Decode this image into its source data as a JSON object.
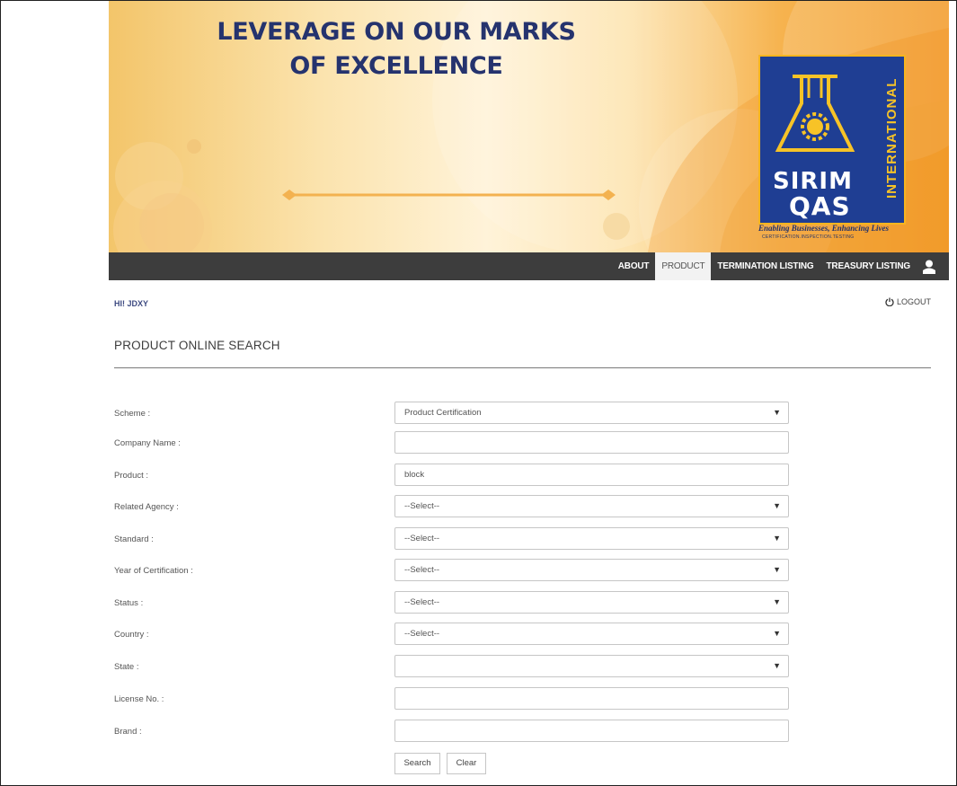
{
  "banner": {
    "headline_line1": "LEVERAGE ON OUR MARKS",
    "headline_line2": "OF EXCELLENCE",
    "logo": {
      "side_text": "INTERNATIONAL",
      "name_line1": "SIRIM",
      "name_line2": "QAS",
      "tagline": "Enabling Businesses, Enhancing Lives",
      "subtagline": "CERTIFICATION.INSPECTION.TESTING"
    },
    "colors": {
      "navy": "#25336e",
      "logo_blue": "#1f3e93",
      "logo_gold": "#f7b51f",
      "orange": "#f39a28"
    }
  },
  "nav": {
    "items": [
      {
        "label": "ABOUT",
        "active": false
      },
      {
        "label": "PRODUCT",
        "active": true
      },
      {
        "label": "TERMINATION LISTING",
        "active": false
      },
      {
        "label": "TREASURY LISTING",
        "active": false
      }
    ],
    "user_icon": "user-icon"
  },
  "header": {
    "greeting": "HI! JDXY",
    "logout_label": "LOGOUT",
    "logout_icon": "power-icon"
  },
  "page": {
    "title": "PRODUCT ONLINE SEARCH"
  },
  "form": {
    "scheme": {
      "label": "Scheme :",
      "value": "Product Certification"
    },
    "company_name": {
      "label": "Company Name :",
      "value": ""
    },
    "product": {
      "label": "Product :",
      "value": "block"
    },
    "related_agency": {
      "label": "Related Agency :",
      "value": "--Select--"
    },
    "standard": {
      "label": "Standard :",
      "value": "--Select--"
    },
    "year_of_certification": {
      "label": "Year of Certification :",
      "value": "--Select--"
    },
    "status": {
      "label": "Status :",
      "value": "--Select--"
    },
    "country": {
      "label": "Country :",
      "value": "--Select--"
    },
    "state": {
      "label": "State :",
      "value": ""
    },
    "license_no": {
      "label": "License No. :",
      "value": ""
    },
    "brand": {
      "label": "Brand :",
      "value": ""
    }
  },
  "buttons": {
    "search_label": "Search",
    "clear_label": "Clear"
  }
}
